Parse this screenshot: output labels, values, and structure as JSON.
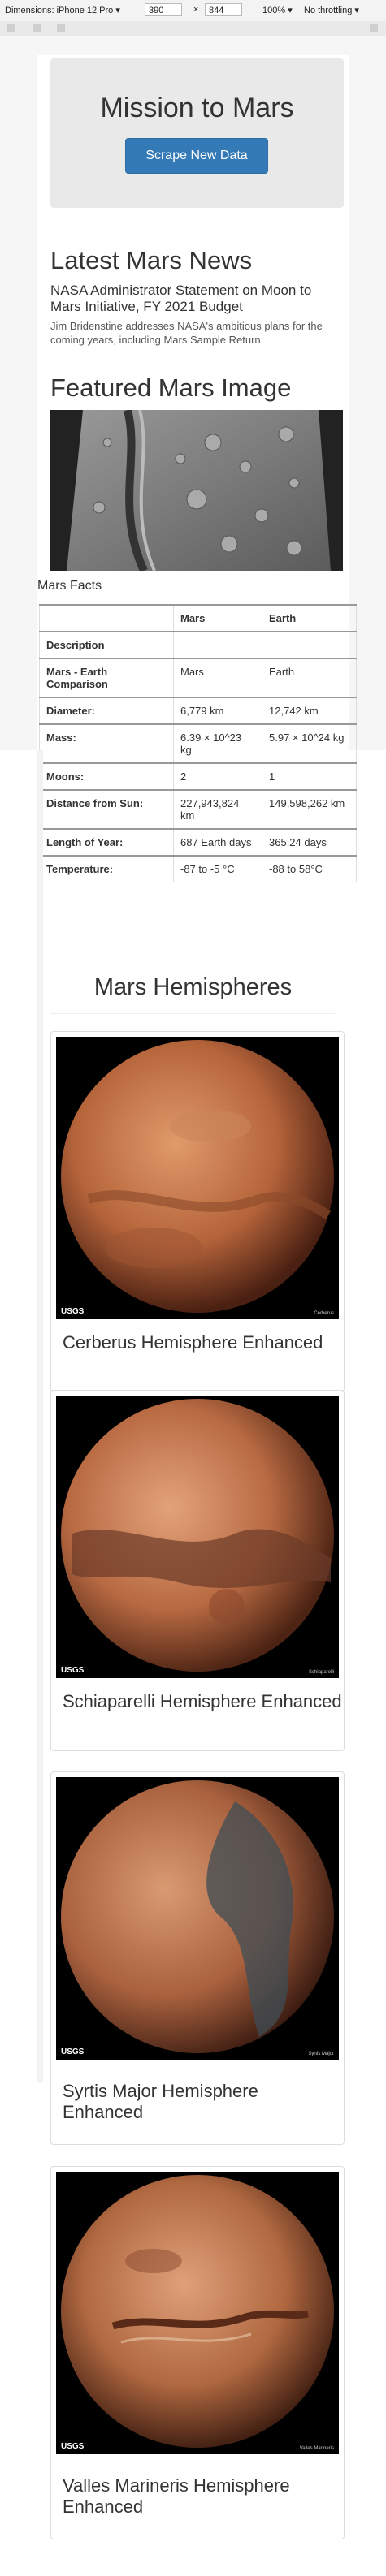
{
  "devtools": {
    "dimensions_label": "Dimensions: iPhone 12 Pro",
    "width": "390",
    "height": "844",
    "zoom": "100%",
    "throttle": "No throttling"
  },
  "header": {
    "title": "Mission to Mars",
    "scrape_label": "Scrape New Data"
  },
  "news": {
    "heading": "Latest Mars News",
    "title": "NASA Administrator Statement on Moon to Mars Initiative, FY 2021 Budget",
    "paragraph": "Jim Bridenstine addresses NASA's ambitious plans for the coming years, including Mars Sample Return."
  },
  "featured": {
    "heading": "Featured Mars Image"
  },
  "facts": {
    "caption": "Mars Facts",
    "columns": [
      "",
      "Mars",
      "Earth"
    ],
    "rows": [
      [
        "Description",
        "",
        ""
      ],
      [
        "Mars - Earth Comparison",
        "Mars",
        "Earth"
      ],
      [
        "Diameter:",
        "6,779 km",
        "12,742 km"
      ],
      [
        "Mass:",
        "6.39 × 10^23 kg",
        "5.97 × 10^24 kg"
      ],
      [
        "Moons:",
        "2",
        "1"
      ],
      [
        "Distance from Sun:",
        "227,943,824 km",
        "149,598,262 km"
      ],
      [
        "Length of Year:",
        "687 Earth days",
        "365.24 days"
      ],
      [
        "Temperature:",
        "-87 to -5 °C",
        "-88 to 58°C"
      ]
    ]
  },
  "hemispheres": {
    "heading": "Mars Hemispheres",
    "items": [
      {
        "title": "Cerberus Hemisphere Enhanced",
        "label": "Cerberus"
      },
      {
        "title": "Schiaparelli Hemisphere Enhanced",
        "label": "Schiaparelli"
      },
      {
        "title": "Syrtis Major Hemisphere Enhanced",
        "label": "Syrtis Major"
      },
      {
        "title": "Valles Marineris Hemisphere Enhanced",
        "label": "Valles Marineris"
      }
    ],
    "usgs": "USGS"
  }
}
